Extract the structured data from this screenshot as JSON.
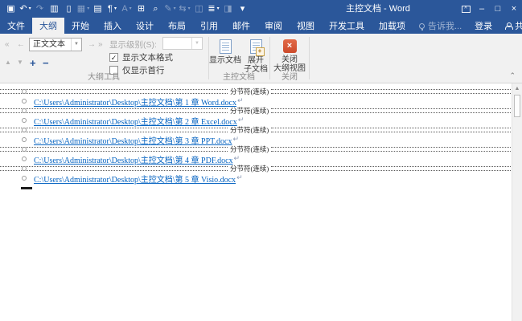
{
  "window": {
    "title": "主控文档 - Word",
    "controls": [
      {
        "name": "ribbon-display-options-button",
        "glyph": "^"
      },
      {
        "name": "minimize-button",
        "glyph": "–"
      },
      {
        "name": "maximize-button",
        "glyph": "□"
      },
      {
        "name": "close-button",
        "glyph": "×"
      }
    ]
  },
  "qat": {
    "icons": [
      {
        "name": "save-icon",
        "glyph": "▣"
      },
      {
        "name": "undo-icon",
        "glyph": "↶",
        "dd": true
      },
      {
        "name": "redo-icon",
        "glyph": "↷",
        "dim": true
      },
      {
        "name": "print-preview-icon",
        "glyph": "▥"
      },
      {
        "name": "new-document-icon",
        "glyph": "▯"
      },
      {
        "name": "quick-table-icon",
        "glyph": "▦",
        "dim": true,
        "dd": true
      },
      {
        "name": "reading-layout-icon",
        "glyph": "▤"
      },
      {
        "name": "paragraph-marks-icon",
        "glyph": "¶",
        "dd": true
      },
      {
        "name": "font-icon",
        "glyph": "A",
        "dim": true,
        "dd": true
      },
      {
        "name": "book-icon",
        "glyph": "⊞"
      },
      {
        "name": "search-icon",
        "glyph": "⌕"
      },
      {
        "name": "draw-icon",
        "glyph": "✎",
        "dim": true,
        "dd": true
      },
      {
        "name": "arrows-icon",
        "glyph": "⇆",
        "dim": true,
        "dd": true
      },
      {
        "name": "window-icon",
        "glyph": "◫",
        "dim": true
      },
      {
        "name": "list-icon",
        "glyph": "≣",
        "dd": true
      },
      {
        "name": "macro-icon",
        "glyph": "◨",
        "dim": true
      },
      {
        "name": "qat-customize-icon",
        "glyph": "▾"
      }
    ]
  },
  "tabs": [
    {
      "name": "tab-file",
      "label": "文件"
    },
    {
      "name": "tab-outline",
      "label": "大纲",
      "active": true
    },
    {
      "name": "tab-home",
      "label": "开始"
    },
    {
      "name": "tab-insert",
      "label": "插入"
    },
    {
      "name": "tab-design",
      "label": "设计"
    },
    {
      "name": "tab-layout",
      "label": "布局"
    },
    {
      "name": "tab-references",
      "label": "引用"
    },
    {
      "name": "tab-mailings",
      "label": "邮件"
    },
    {
      "name": "tab-review",
      "label": "审阅"
    },
    {
      "name": "tab-view",
      "label": "视图"
    },
    {
      "name": "tab-developer",
      "label": "开发工具"
    },
    {
      "name": "tab-addins",
      "label": "加载项"
    }
  ],
  "tell_me": "告诉我...",
  "account": {
    "sign_in": "登录",
    "share": "共享"
  },
  "ribbon": {
    "outline_tools": {
      "label": "大纲工具",
      "promote_heading1": "«",
      "promote": "←",
      "level_value": "正文文本",
      "demote": "→",
      "demote_body": "»",
      "move_up": "▲",
      "move_down": "▼",
      "expand": "+",
      "collapse": "−",
      "show_level_label": "显示级别(S):",
      "checkbox_text_format": {
        "label": "显示文本格式",
        "checked": "✓"
      },
      "checkbox_first_line": {
        "label": "仅显示首行"
      }
    },
    "master_document": {
      "label": "主控文档",
      "buttons": [
        {
          "name": "show-document-button",
          "lines": [
            "显示文档",
            ""
          ]
        },
        {
          "name": "expand-subdocuments-button",
          "lines": [
            "展开",
            "子文档"
          ]
        }
      ]
    },
    "close_group": {
      "label": "关闭",
      "button": {
        "lines": [
          "关闭",
          "大纲视图"
        ],
        "icon_glyph": "×"
      }
    }
  },
  "document": {
    "section_break_label": "分节符(连续)",
    "return_mark": "↵",
    "links": [
      "C:\\Users\\Administrator\\Desktop\\主控文档\\第 1 章 Word.docx",
      "C:\\Users\\Administrator\\Desktop\\主控文档\\第 2 章 Excel.docx",
      "C:\\Users\\Administrator\\Desktop\\主控文档\\第 3 章 PPT.docx",
      "C:\\Users\\Administrator\\Desktop\\主控文档\\第 4 章 PDF.docx",
      "C:\\Users\\Administrator\\Desktop\\主控文档\\第 5 章 Visio.docx"
    ]
  },
  "colors": {
    "accent": "#2b579a",
    "ribbon_bg": "#f1f1f1",
    "link": "#0563c1",
    "close_icon": "#cc4a2b"
  }
}
